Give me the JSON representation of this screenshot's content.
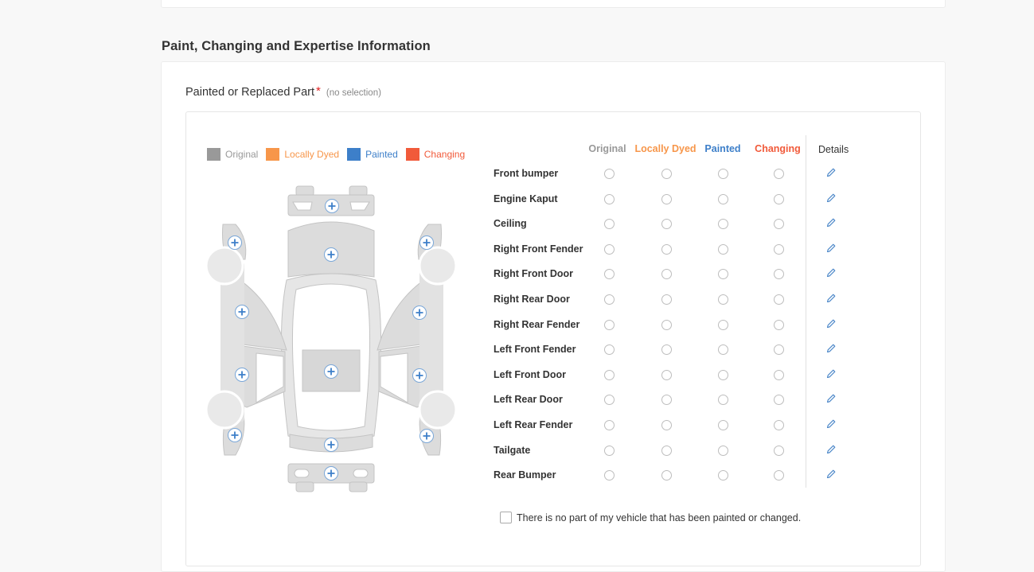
{
  "section": {
    "title": "Paint, Changing and Expertise Information"
  },
  "field": {
    "label": "Painted or Replaced Part",
    "required_mark": "*",
    "hint": "(no selection)"
  },
  "legend": [
    {
      "label": "Original",
      "color": "#999999"
    },
    {
      "label": "Locally Dyed",
      "color": "#f7964a"
    },
    {
      "label": "Painted",
      "color": "#3d7fc9"
    },
    {
      "label": "Changing",
      "color": "#f15a3a"
    }
  ],
  "table": {
    "columns": [
      {
        "label": "Original",
        "color": "#999999"
      },
      {
        "label": "Locally Dyed",
        "color": "#f7964a"
      },
      {
        "label": "Painted",
        "color": "#3d7fc9"
      },
      {
        "label": "Changing",
        "color": "#f15a3a"
      }
    ],
    "details_label": "Details",
    "rows": [
      "Front bumper",
      "Engine Kaput",
      "Ceiling",
      "Right Front Fender",
      "Right Front Door",
      "Right Rear Door",
      "Right Rear Fender",
      "Left Front Fender",
      "Left Front Door",
      "Left Rear Door",
      "Left Rear Fender",
      "Tailgate",
      "Rear Bumper"
    ]
  },
  "no_part_checkbox": {
    "label": "There is no part of my vehicle that has been painted or changed.",
    "checked": false
  },
  "icons": {
    "add_part": "plus-circle-icon",
    "details": "pencil-icon"
  }
}
